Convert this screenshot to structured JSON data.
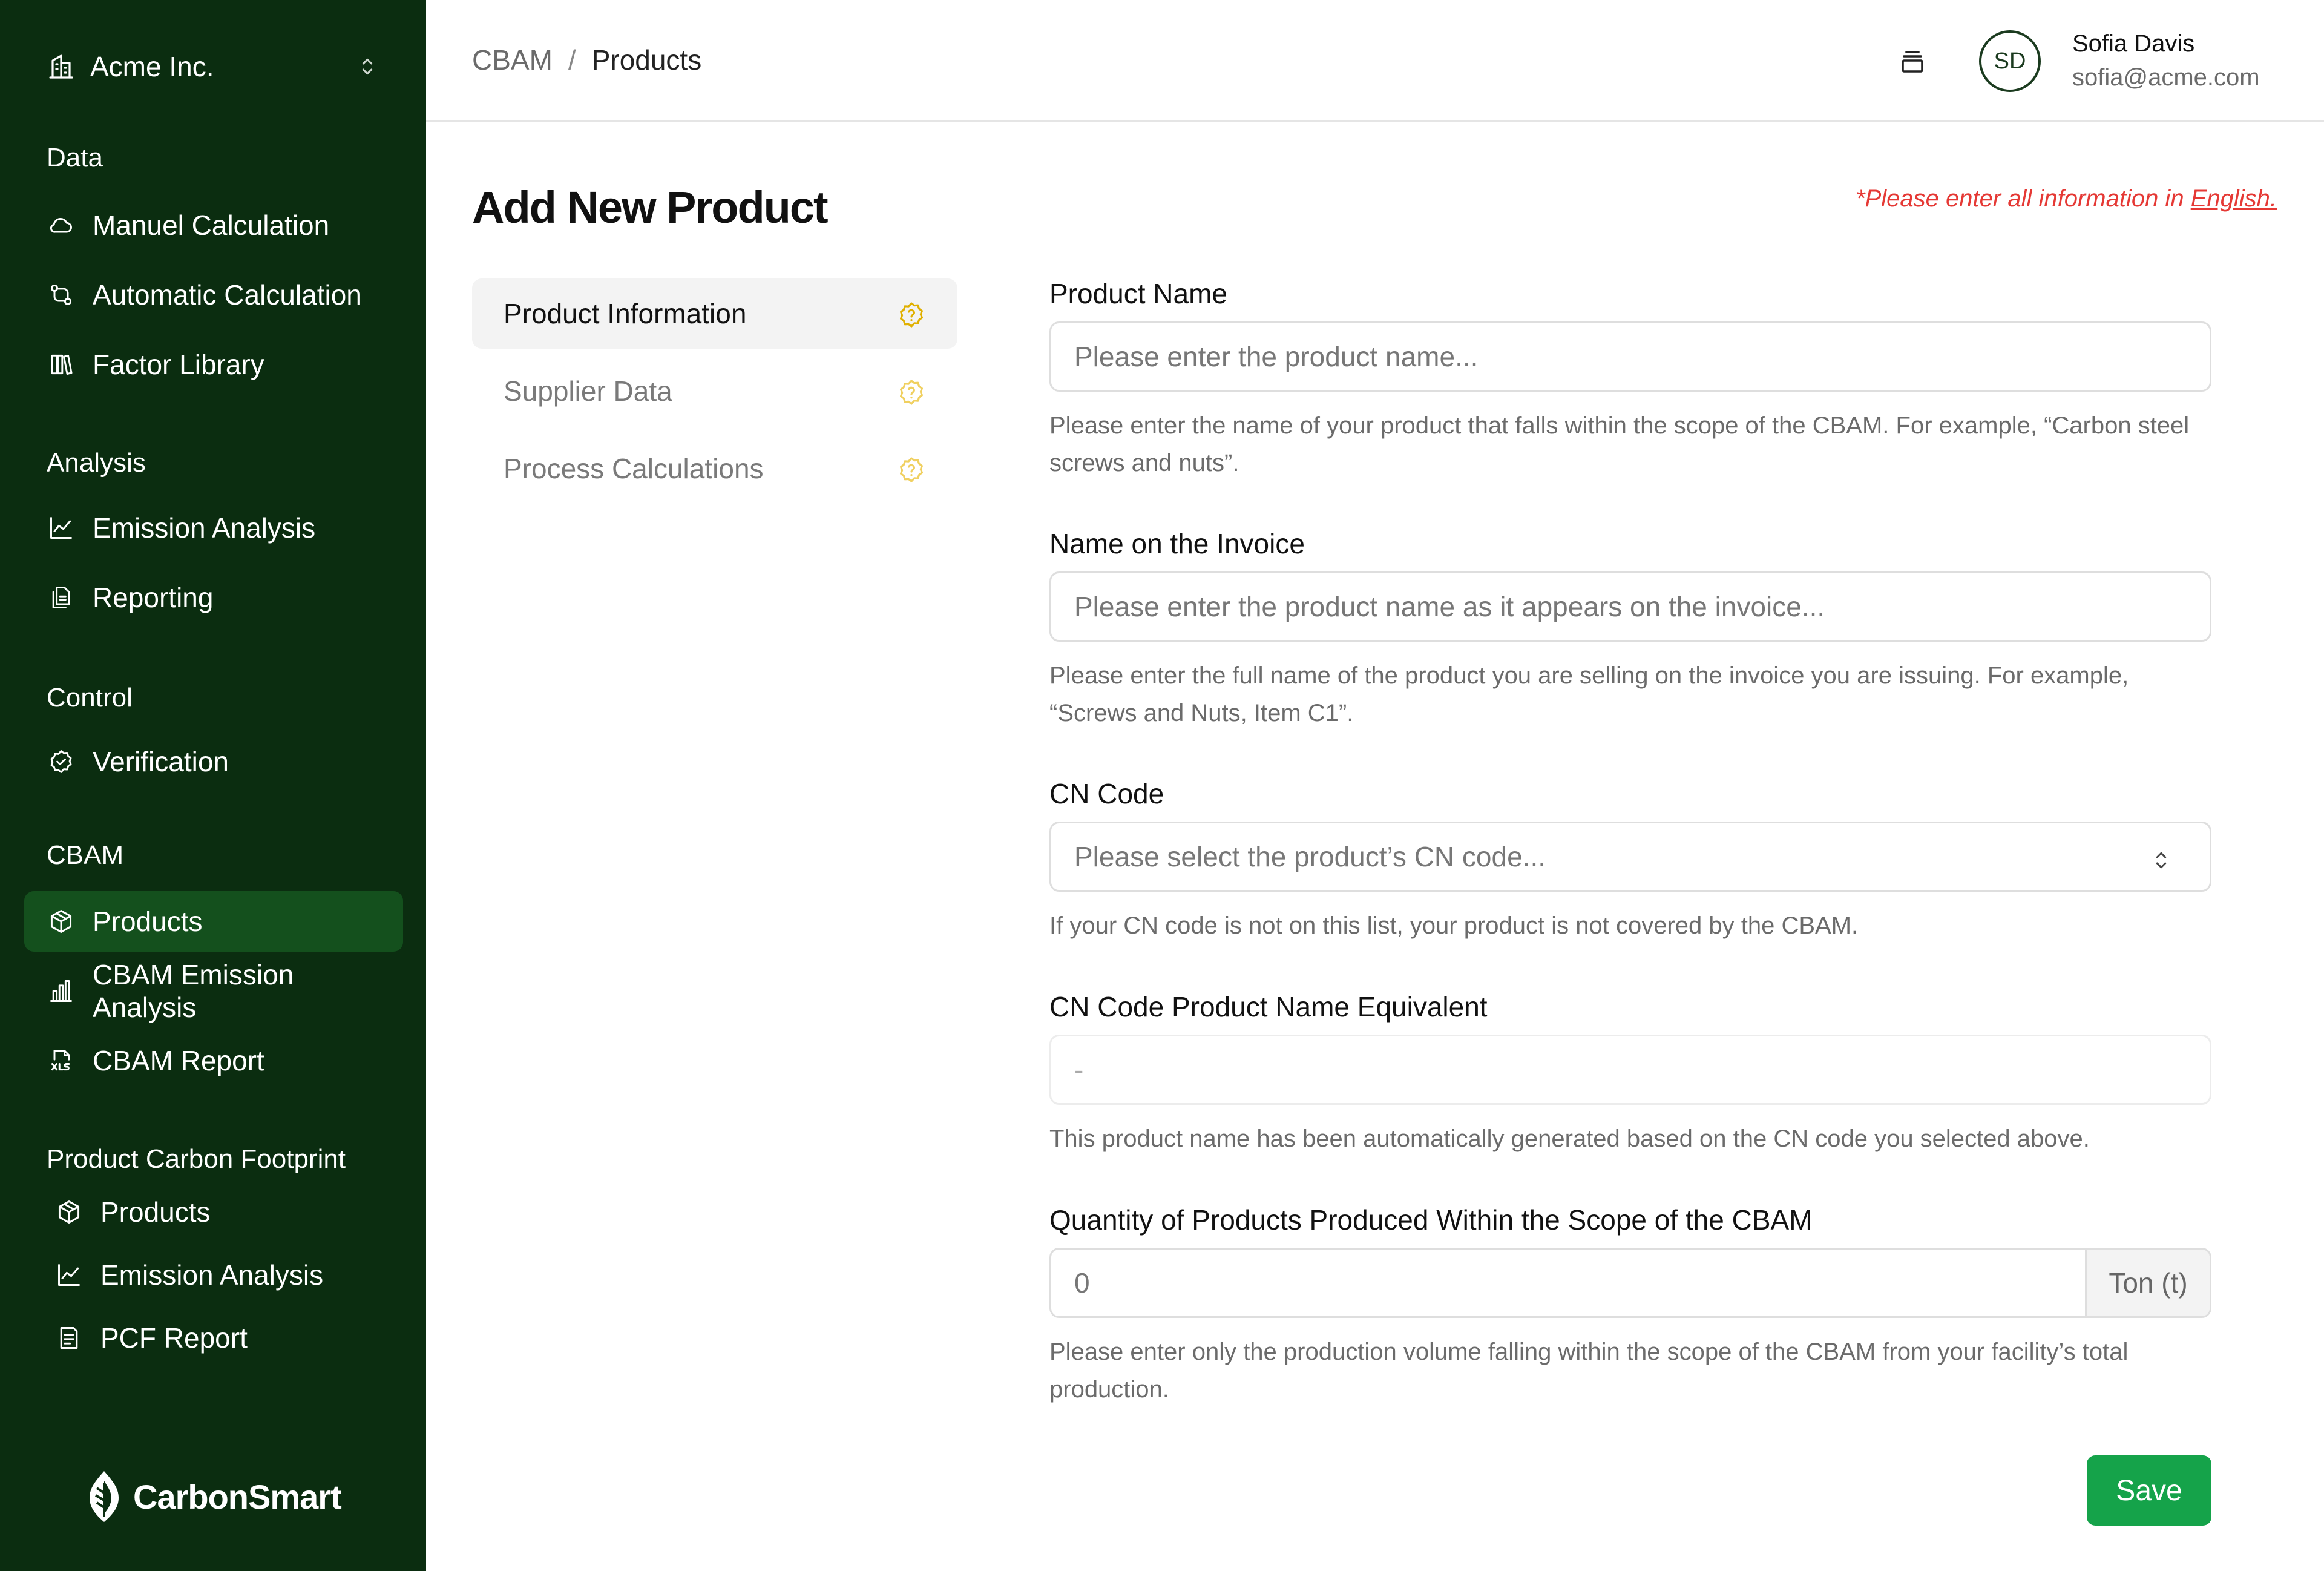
{
  "sidebar": {
    "org_name": "Acme Inc.",
    "sections": {
      "data": "Data",
      "analysis": "Analysis",
      "control": "Control",
      "cbam": "CBAM",
      "pcf": "Product Carbon Footprint"
    },
    "items": {
      "manual_calc": "Manuel Calculation",
      "auto_calc": "Automatic Calculation",
      "factor_library": "Factor Library",
      "emission_analysis": "Emission Analysis",
      "reporting": "Reporting",
      "verification": "Verification",
      "cbam_products": "Products",
      "cbam_emission_analysis": "CBAM Emission Analysis",
      "cbam_report": "CBAM Report",
      "pcf_products": "Products",
      "pcf_emission_analysis": "Emission Analysis",
      "pcf_report": "PCF Report"
    },
    "active_item": "cbam_products",
    "brand": "CarbonSmart"
  },
  "header": {
    "breadcrumb": [
      "CBAM",
      "Products"
    ],
    "breadcrumb_sep": "/",
    "user": {
      "initials": "SD",
      "name": "Sofia Davis",
      "email": "sofia@acme.com"
    }
  },
  "main": {
    "title": "Add New Product",
    "note_prefix": "*Please enter all information in ",
    "note_link": "English.",
    "steps": [
      "Product Information",
      "Supplier Data",
      "Process Calculations"
    ],
    "active_step": 0,
    "fields": {
      "product_name": {
        "label": "Product Name",
        "placeholder": "Please enter the product name...",
        "help": "Please enter the name of your product that falls within the scope of the CBAM. For example, “Carbon steel screws and nuts”."
      },
      "invoice_name": {
        "label": "Name on the Invoice",
        "placeholder": "Please enter the product name as it appears on the invoice...",
        "help": "Please enter the full name of the product you are selling on the invoice you are issuing. For example, “Screws and Nuts, Item C1”."
      },
      "cn_code": {
        "label": "CN Code",
        "placeholder": "Please select the product’s CN code...",
        "help": "If your CN code is not on this list, your product is not covered by the CBAM."
      },
      "cn_equivalent": {
        "label": "CN Code Product Name Equivalent",
        "value": "-",
        "help": "This product name has been automatically generated based on the CN code you selected above."
      },
      "quantity": {
        "label": "Quantity of Products Produced Within the Scope of the CBAM",
        "value": "0",
        "unit": "Ton (t)",
        "help": "Please enter only the production volume falling within the scope of the CBAM from your facility’s total production."
      }
    },
    "save_label": "Save"
  },
  "colors": {
    "sidebar_bg": "#0b2d10",
    "sidebar_active": "#14501d",
    "primary_button": "#15a34a",
    "warning_text": "#e53935",
    "step_icon": "#e0b000"
  }
}
